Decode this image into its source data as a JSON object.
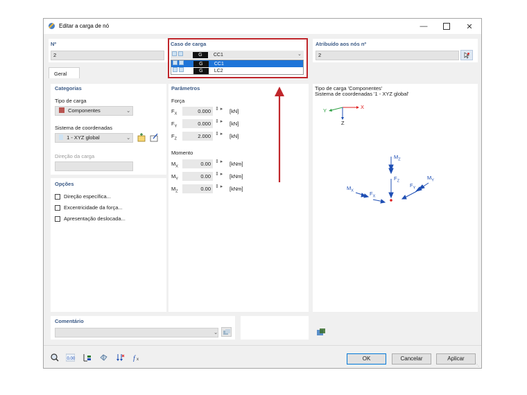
{
  "window": {
    "title": "Editar a carga de nó",
    "minimize_icon": "minimize-icon",
    "maximize_icon": "maximize-icon",
    "close_icon": "close-icon"
  },
  "header": {
    "no_label": "Nº",
    "no_value": "2",
    "load_case_label": "Caso de carga",
    "load_case_selected": {
      "group": "G",
      "name": "CC1"
    },
    "load_case_options": [
      {
        "group": "G",
        "name": "CC1"
      },
      {
        "group": "G",
        "name": "LC2"
      }
    ],
    "assigned_label": "Atribuído aos nós nº",
    "assigned_value": "2"
  },
  "tabs": [
    {
      "label": "Geral"
    }
  ],
  "categories": {
    "title": "Categorias",
    "load_type_label": "Tipo de carga",
    "load_type_value": "Componentes",
    "load_type_color": "#b85450",
    "coord_system_label": "Sistema de coordenadas",
    "coord_system_value": "1 - XYZ global",
    "load_direction_label": "Direção da carga"
  },
  "options": {
    "title": "Opções",
    "items": [
      {
        "label": "Direção específica...",
        "checked": false
      },
      {
        "label": "Excentricidade da força...",
        "checked": false
      },
      {
        "label": "Apresentação deslocada...",
        "checked": false
      }
    ]
  },
  "parameters": {
    "title": "Parâmetros",
    "force_label": "Força",
    "force_rows": [
      {
        "symbol": "F",
        "sub": "X",
        "value": "0.000",
        "unit": "[kN]"
      },
      {
        "symbol": "F",
        "sub": "Y",
        "value": "0.000",
        "unit": "[kN]"
      },
      {
        "symbol": "F",
        "sub": "Z",
        "value": "2.000",
        "unit": "[kN]"
      }
    ],
    "moment_label": "Momento",
    "moment_rows": [
      {
        "symbol": "M",
        "sub": "X",
        "value": "0.00",
        "unit": "[kNm]"
      },
      {
        "symbol": "M",
        "sub": "Y",
        "value": "0.00",
        "unit": "[kNm]"
      },
      {
        "symbol": "M",
        "sub": "Z",
        "value": "0.00",
        "unit": "[kNm]"
      }
    ]
  },
  "preview": {
    "line1": "Tipo de carga 'Componentes'",
    "line2": "Sistema de coordenadas '1 - XYZ global'",
    "axis_y": "Y",
    "axis_x": "X",
    "axis_z": "Z",
    "labels": {
      "mz": "M",
      "mz_sub": "Z",
      "fz": "F",
      "fz_sub": "Z",
      "my": "M",
      "my_sub": "Y",
      "fy": "F",
      "fy_sub": "Y",
      "mx": "M",
      "mx_sub": "X",
      "fx": "F",
      "fx_sub": "X"
    }
  },
  "comment": {
    "title": "Comentário",
    "value": ""
  },
  "footer": {
    "ok": "OK",
    "cancel": "Cancelar",
    "apply": "Aplicar"
  },
  "colors": {
    "highlight_red": "#c0262b",
    "selection_blue": "#1e74d8",
    "section_title": "#3b5a86",
    "axis_red": "#e02020",
    "axis_green": "#2ea043",
    "axis_blue": "#1f4fb4"
  }
}
